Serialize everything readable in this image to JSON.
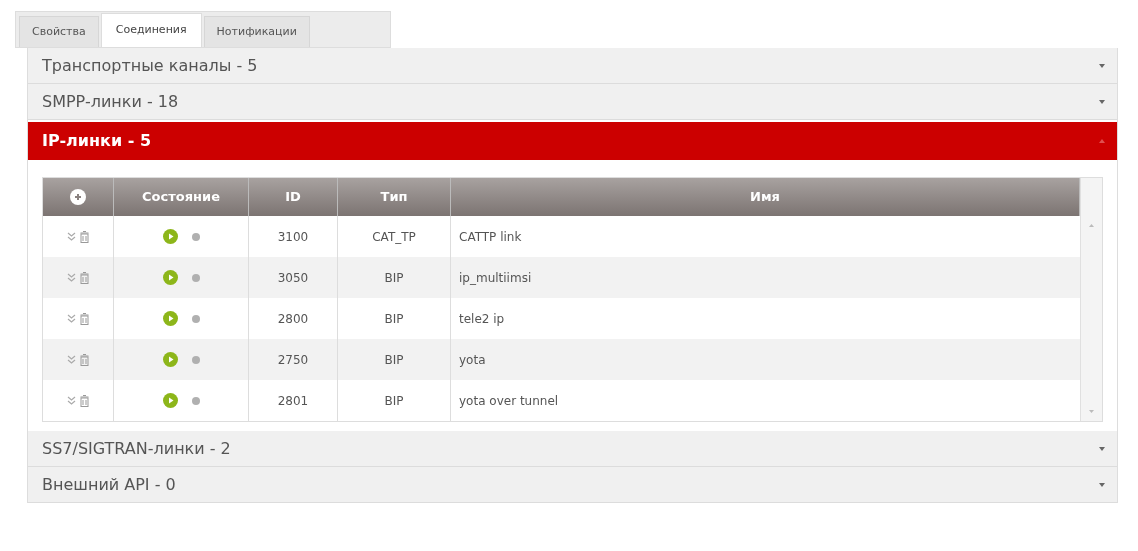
{
  "tabs": [
    {
      "label": "Свойства",
      "selected": false
    },
    {
      "label": "Соединения",
      "selected": true
    },
    {
      "label": "Нотификации",
      "selected": false
    }
  ],
  "sections": [
    {
      "title": "Транспортные каналы - 5",
      "expanded": false
    },
    {
      "title": "SMPP-линки - 18",
      "expanded": false
    },
    {
      "title": "IP-линки - 5",
      "expanded": true,
      "table": {
        "columns": [
          "Состояние",
          "ID",
          "Тип",
          "Имя"
        ],
        "rows": [
          {
            "id": "3100",
            "type": "CAT_TP",
            "name": "CATTP link"
          },
          {
            "id": "3050",
            "type": "BIP",
            "name": "ip_multiimsi"
          },
          {
            "id": "2800",
            "type": "BIP",
            "name": "tele2 ip"
          },
          {
            "id": "2750",
            "type": "BIP",
            "name": "yota"
          },
          {
            "id": "2801",
            "type": "BIP",
            "name": "yota over tunnel"
          }
        ]
      }
    },
    {
      "title": "SS7/SIGTRAN-линки - 2",
      "expanded": false
    },
    {
      "title": "Внешний API - 0",
      "expanded": false
    }
  ]
}
